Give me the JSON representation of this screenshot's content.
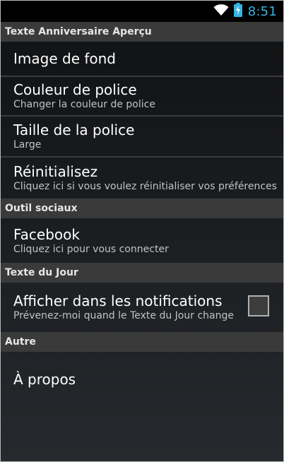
{
  "status_bar": {
    "time": "8:51",
    "icons": [
      "wifi-icon",
      "battery-charging-icon"
    ]
  },
  "sections": [
    {
      "header": "Texte Anniversaire Aperçu",
      "items": [
        {
          "title": "Image de fond",
          "summary": ""
        },
        {
          "title": "Couleur de police",
          "summary": "Changer la couleur de police"
        },
        {
          "title": "Taille de la police",
          "summary": "Large"
        },
        {
          "title": "Réinitialisez",
          "summary": "Cliquez ici si vous voulez réinitialiser vos préférences"
        }
      ]
    },
    {
      "header": "Outil sociaux",
      "items": [
        {
          "title": "Facebook",
          "summary": "Cliquez ici pour vous connecter"
        }
      ]
    },
    {
      "header": "Texte du Jour",
      "items": [
        {
          "title": "Afficher dans les notifications",
          "summary": "Prévenez-moi quand le Texte du Jour change",
          "checked": false
        }
      ]
    },
    {
      "header": "Autre",
      "items": [
        {
          "title": "À propos",
          "summary": ""
        }
      ]
    }
  ],
  "colors": {
    "accent": "#33b5e5",
    "header_bg": "#3a3a3a",
    "text": "#ffffff",
    "summary": "#c2c2c2"
  }
}
